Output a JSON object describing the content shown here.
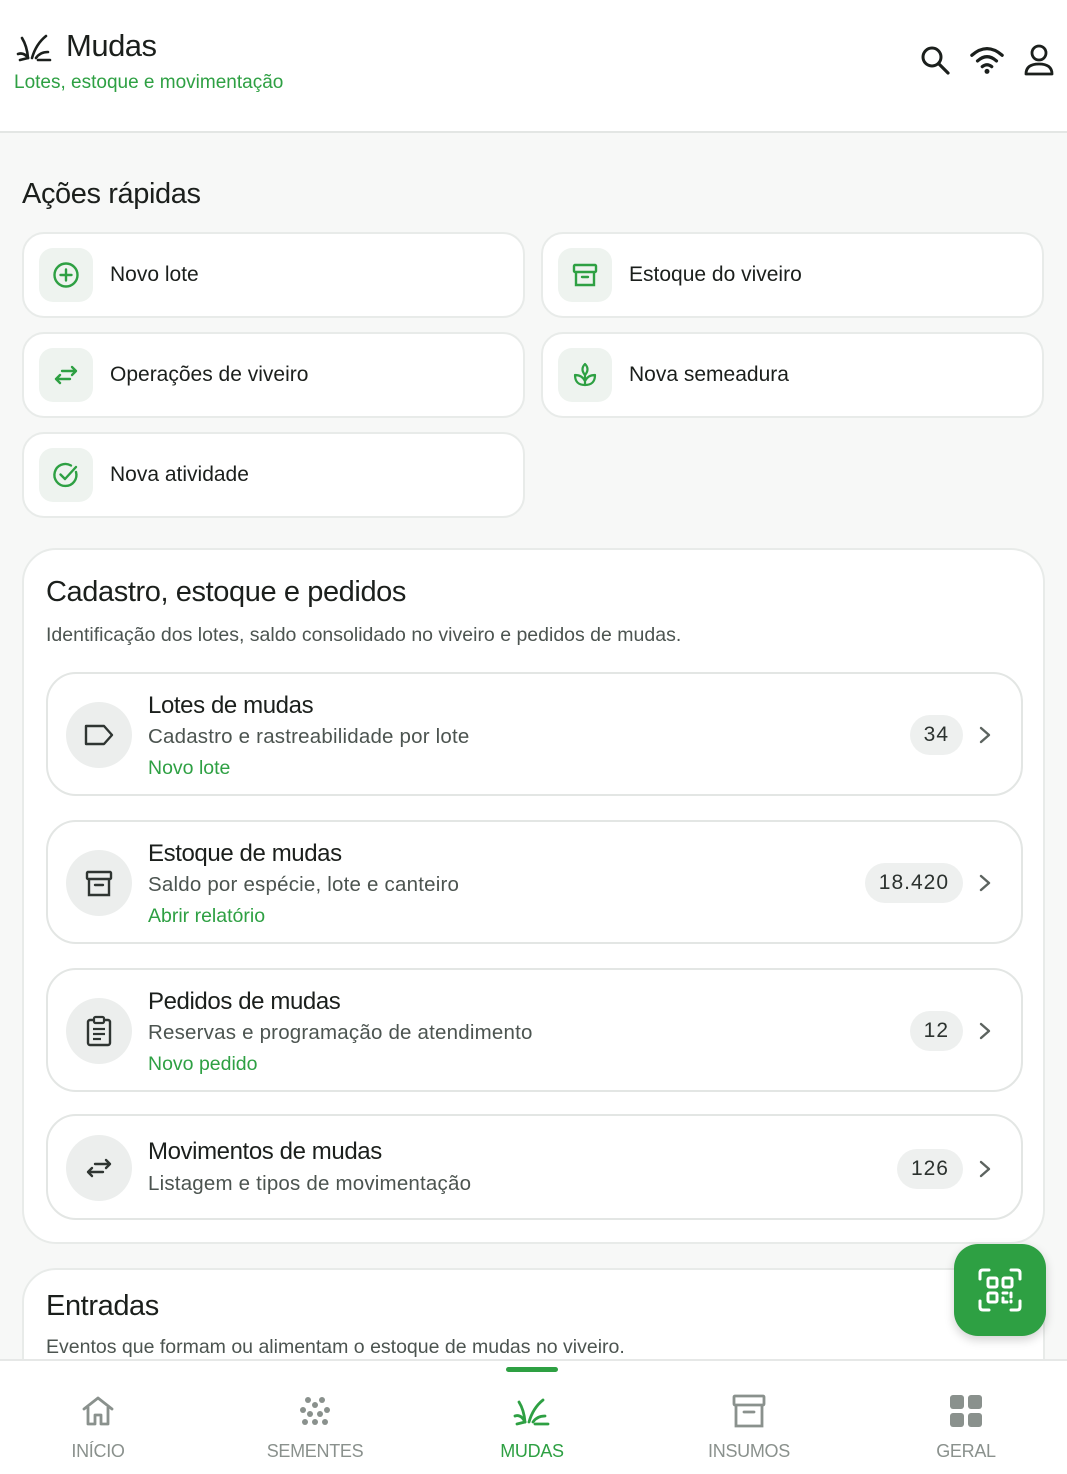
{
  "header": {
    "title": "Mudas",
    "subtitle": "Lotes, estoque e movimentação",
    "icons": [
      "search-icon",
      "wifi-icon",
      "user-icon"
    ]
  },
  "quick_actions": {
    "title": "Ações rápidas",
    "items": [
      {
        "label": "Novo lote",
        "icon": "plus-circle-icon"
      },
      {
        "label": "Estoque do viveiro",
        "icon": "archive-box-icon"
      },
      {
        "label": "Operações de viveiro",
        "icon": "swap-arrows-icon"
      },
      {
        "label": "Nova semeadura",
        "icon": "sprout-icon"
      },
      {
        "label": "Nova atividade",
        "icon": "check-circle-icon"
      }
    ]
  },
  "catalog": {
    "title": "Cadastro, estoque e pedidos",
    "subtitle": "Identificação dos lotes, saldo consolidado no viveiro e pedidos de mudas.",
    "rows": [
      {
        "title": "Lotes de mudas",
        "desc": "Cadastro e rastreabilidade por lote",
        "action": "Novo lote",
        "count": "34",
        "icon": "tag-icon"
      },
      {
        "title": "Estoque de mudas",
        "desc": "Saldo por espécie, lote e canteiro",
        "action": "Abrir relatório",
        "count": "18.420",
        "icon": "archive-box-icon"
      },
      {
        "title": "Pedidos de mudas",
        "desc": "Reservas e programação de atendimento",
        "action": "Novo pedido",
        "count": "12",
        "icon": "clipboard-icon"
      },
      {
        "title": "Movimentos de mudas",
        "desc": "Listagem e tipos de movimentação",
        "count": "126",
        "icon": "swap-arrows-icon"
      }
    ]
  },
  "entries": {
    "title": "Entradas",
    "subtitle": "Eventos que formam ou alimentam o estoque de mudas no viveiro."
  },
  "fab": {
    "icon": "qr-scan-icon"
  },
  "bottom_nav": {
    "active": "MUDAS",
    "items": [
      {
        "label": "INÍCIO",
        "icon": "home-icon"
      },
      {
        "label": "SEMENTES",
        "icon": "seeds-icon"
      },
      {
        "label": "MUDAS",
        "icon": "sprout-icon"
      },
      {
        "label": "INSUMOS",
        "icon": "archive-box-icon"
      },
      {
        "label": "GERAL",
        "icon": "grid-icon"
      }
    ]
  },
  "colors": {
    "accent": "#2ea043",
    "text": "#1b1f1c",
    "muted": "#4c5450",
    "background": "#f7f8f7"
  }
}
